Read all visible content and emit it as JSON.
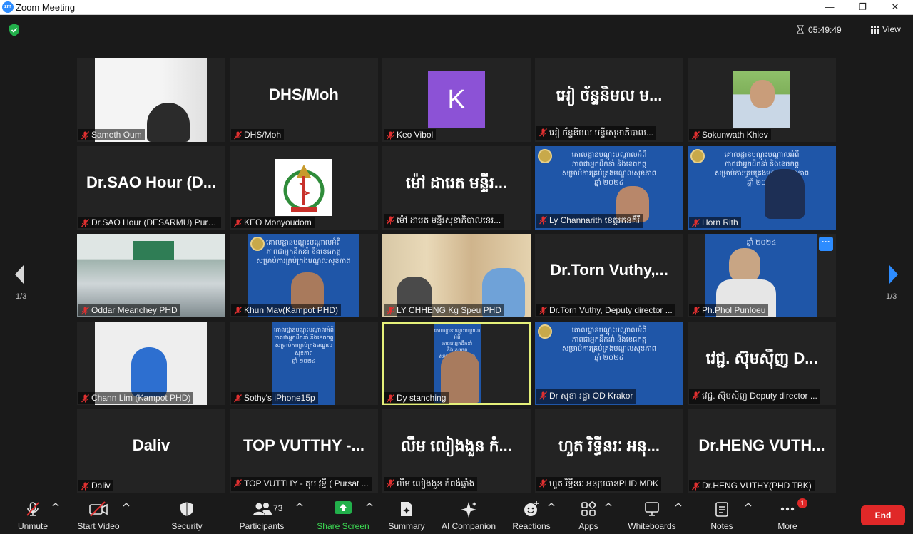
{
  "window": {
    "app_icon": "zm",
    "title": "Zoom Meeting",
    "minimize": "—",
    "maximize": "❐",
    "close": "✕"
  },
  "topbar": {
    "timer": "05:49:49",
    "view_label": "View"
  },
  "navigation": {
    "page_left": "1/3",
    "page_right": "1/3"
  },
  "tiles": [
    {
      "label": "Sameth Oum",
      "display": ""
    },
    {
      "label": "DHS/Moh",
      "display": "DHS/Moh"
    },
    {
      "label": "Keo Vibol",
      "display": "",
      "avatar": "K",
      "avatar_color": "#8c52d6"
    },
    {
      "label": "អៀ ច័ន្ទនិមល មន្ទីរសុខាភិបាល...",
      "display": "អៀ ច័ន្ទនិមល ម..."
    },
    {
      "label": "Sokunwath Khiev",
      "display": ""
    },
    {
      "label": "Dr.SAO Hour (DESARMU) Pursa...",
      "display": "Dr.SAO Hour (D..."
    },
    {
      "label": "KEO Monyoudom",
      "display": ""
    },
    {
      "label": "ម៉ៅ ដារេត មន្ទីរសុខាភិបាលនេរ...",
      "display": "ម៉ៅ ដារេត មន្ទីរ..."
    },
    {
      "label": "Ly Channarith ខេត្តរតនគិរី",
      "display": ""
    },
    {
      "label": "Horn Rith",
      "display": ""
    },
    {
      "label": "Oddar Meanchey PHD",
      "display": ""
    },
    {
      "label": "Khun Mav(Kampot PHD)",
      "display": ""
    },
    {
      "label": "LY CHHENG Kg Speu PHD",
      "display": ""
    },
    {
      "label": "Dr.Torn Vuthy, Deputy director ...",
      "display": "Dr.Torn Vuthy,..."
    },
    {
      "label": "Ph.Phol Punloeu",
      "display": ""
    },
    {
      "label": "Chann Lim (Kampot PHD)",
      "display": ""
    },
    {
      "label": "Sothy's iPhone15p",
      "display": ""
    },
    {
      "label": "Dy stanching",
      "display": ""
    },
    {
      "label": "Dr សុខា រដ្ឋា OD Krakor",
      "display": ""
    },
    {
      "label": "វេជ្ជ. ស៊ុមស៊ីញ Deputy director ...",
      "display": "វេជ្ជ. ស៊ុមស៊ីញ D..."
    },
    {
      "label": "Daliv",
      "display": "Daliv"
    },
    {
      "label": "TOP VUTTHY - តុប វុទ្ធី ( Pursat ...",
      "display": "TOP VUTTHY -..."
    },
    {
      "label": "លឹម លៀងងួន កំពង់ឆ្នាំង",
      "display": "លឹម លៀងងួន កំ..."
    },
    {
      "label": "ហួត រិទ្ធីនរៈ អនុប្រធានPHD MDK",
      "display": "ហួត រិទ្ធីនរៈ អនុ..."
    },
    {
      "label": "Dr.HENG VUTHY(PHD TBK)",
      "display": "Dr.HENG VUTH..."
    }
  ],
  "slide_text": {
    "line1": "គោលដ្ឋានបណ្តុះបណ្តាលអំពី",
    "line2": "ភាពជាអ្នកដឹកនាំ និងខេធកត្ត",
    "line3": "សម្រាប់ការគ្រប់គ្រងមណ្ឌលសុខភាព",
    "line4": "ឆ្នាំ ២០២៤"
  },
  "toolbar": {
    "unmute": "Unmute",
    "start_video": "Start Video",
    "security": "Security",
    "participants": "Participants",
    "participants_count": "73",
    "share_screen": "Share Screen",
    "summary": "Summary",
    "ai_companion": "AI Companion",
    "reactions": "Reactions",
    "apps": "Apps",
    "whiteboards": "Whiteboards",
    "notes": "Notes",
    "more": "More",
    "more_badge": "1",
    "end": "End"
  },
  "colors": {
    "accent_blue": "#2d8cff",
    "end_red": "#e02828",
    "active_speaker": "#e5f07a",
    "share_green": "#3ddc54"
  }
}
